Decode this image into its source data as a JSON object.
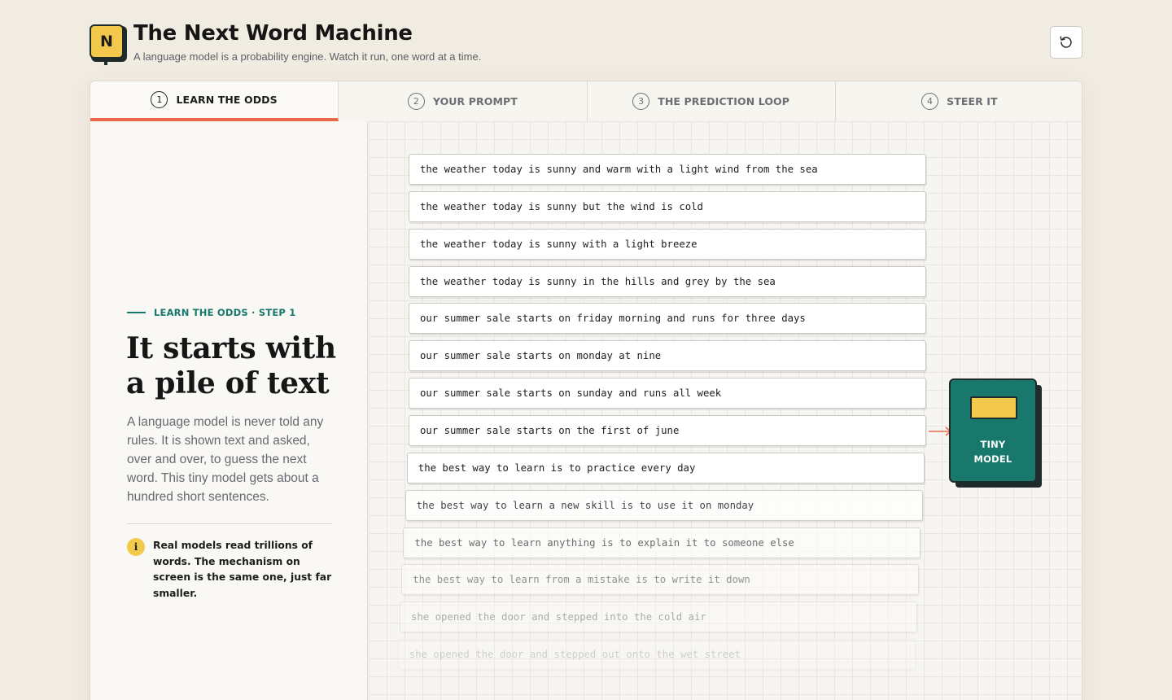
{
  "app": {
    "logo_letter": "N",
    "title": "The Next Word Machine",
    "subtitle": "A language model is a probability engine. Watch it run, one word at a time.",
    "reset_icon": "reset-icon"
  },
  "tabs": [
    {
      "num": "1",
      "label": "LEARN THE ODDS",
      "active": true
    },
    {
      "num": "2",
      "label": "YOUR PROMPT",
      "active": false
    },
    {
      "num": "3",
      "label": "THE PREDICTION LOOP",
      "active": false
    },
    {
      "num": "4",
      "label": "STEER IT",
      "active": false
    }
  ],
  "left": {
    "kicker": "LEARN THE ODDS · STEP 1",
    "headline": "It starts with a pile of text",
    "body": "A language model is never told any rules. It is shown text and asked, over and over, to guess the next word. This tiny model gets about a hundred short sentences.",
    "note_icon": "i",
    "note": "Real models read trillions of words. The mechanism on screen is the same one, just far smaller."
  },
  "sentences": [
    "the weather today is sunny and warm with a light wind from the sea",
    "the weather today is sunny but the wind is cold",
    "the weather today is sunny with a light breeze",
    "the weather today is sunny in the hills and grey by the sea",
    "our summer sale starts on friday morning and runs for three days",
    "our summer sale starts on monday at nine",
    "our summer sale starts on sunday and runs all week",
    "our summer sale starts on the first of june",
    "the best way to learn is to practice every day",
    "the best way to learn a new skill is to use it on monday",
    "the best way to learn anything is to explain it to someone else",
    "the best way to learn from a mistake is to write it down",
    "she opened the door and stepped into the cold air",
    "she opened the door and stepped out onto the wet street"
  ],
  "model": {
    "label_line1": "TINY",
    "label_line2": "MODEL"
  },
  "colors": {
    "background": "#f1ece2",
    "accent_red": "#e8684a",
    "teal": "#17786b",
    "yellow": "#f2c94c",
    "dark": "#1f2b2b"
  }
}
